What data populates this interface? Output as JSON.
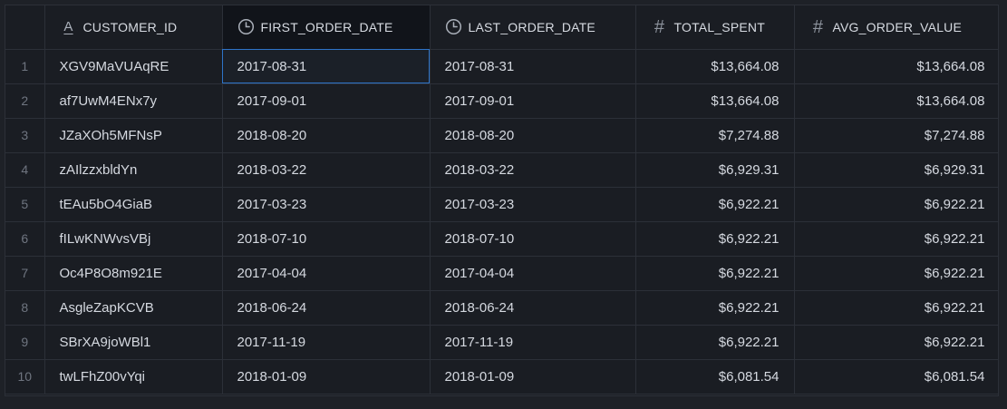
{
  "columns": [
    {
      "label": "",
      "icon": "none"
    },
    {
      "label": "CUSTOMER_ID",
      "icon": "text-type-icon"
    },
    {
      "label": "FIRST_ORDER_DATE",
      "icon": "clock-icon"
    },
    {
      "label": "LAST_ORDER_DATE",
      "icon": "clock-icon"
    },
    {
      "label": "TOTAL_SPENT",
      "icon": "hash-icon"
    },
    {
      "label": "AVG_ORDER_VALUE",
      "icon": "hash-icon"
    }
  ],
  "icons": {
    "text_glyph": "A",
    "hash_glyph": "#"
  },
  "rows": [
    {
      "idx": "1",
      "customer_id": "XGV9MaVUAqRE",
      "first_order_date": "2017-08-31",
      "last_order_date": "2017-08-31",
      "total_spent": "$13,664.08",
      "avg_order_value": "$13,664.08"
    },
    {
      "idx": "2",
      "customer_id": "af7UwM4ENx7y",
      "first_order_date": "2017-09-01",
      "last_order_date": "2017-09-01",
      "total_spent": "$13,664.08",
      "avg_order_value": "$13,664.08"
    },
    {
      "idx": "3",
      "customer_id": "JZaXOh5MFNsP",
      "first_order_date": "2018-08-20",
      "last_order_date": "2018-08-20",
      "total_spent": "$7,274.88",
      "avg_order_value": "$7,274.88"
    },
    {
      "idx": "4",
      "customer_id": "zAIlzzxbldYn",
      "first_order_date": "2018-03-22",
      "last_order_date": "2018-03-22",
      "total_spent": "$6,929.31",
      "avg_order_value": "$6,929.31"
    },
    {
      "idx": "5",
      "customer_id": "tEAu5bO4GiaB",
      "first_order_date": "2017-03-23",
      "last_order_date": "2017-03-23",
      "total_spent": "$6,922.21",
      "avg_order_value": "$6,922.21"
    },
    {
      "idx": "6",
      "customer_id": "fILwKNWvsVBj",
      "first_order_date": "2018-07-10",
      "last_order_date": "2018-07-10",
      "total_spent": "$6,922.21",
      "avg_order_value": "$6,922.21"
    },
    {
      "idx": "7",
      "customer_id": "Oc4P8O8m921E",
      "first_order_date": "2017-04-04",
      "last_order_date": "2017-04-04",
      "total_spent": "$6,922.21",
      "avg_order_value": "$6,922.21"
    },
    {
      "idx": "8",
      "customer_id": "AsgleZapKCVB",
      "first_order_date": "2018-06-24",
      "last_order_date": "2018-06-24",
      "total_spent": "$6,922.21",
      "avg_order_value": "$6,922.21"
    },
    {
      "idx": "9",
      "customer_id": "SBrXA9joWBl1",
      "first_order_date": "2017-11-19",
      "last_order_date": "2017-11-19",
      "total_spent": "$6,922.21",
      "avg_order_value": "$6,922.21"
    },
    {
      "idx": "10",
      "customer_id": "twLFhZ00vYqi",
      "first_order_date": "2018-01-09",
      "last_order_date": "2018-01-09",
      "total_spent": "$6,081.54",
      "avg_order_value": "$6,081.54"
    }
  ],
  "selection": {
    "row": 0,
    "column": "first_order_date"
  },
  "colors": {
    "background": "#1a1d23",
    "border": "#2c3038",
    "selection_outline": "#2e74c8",
    "text": "#d5d9e0",
    "row_index_text": "#6f7580"
  }
}
